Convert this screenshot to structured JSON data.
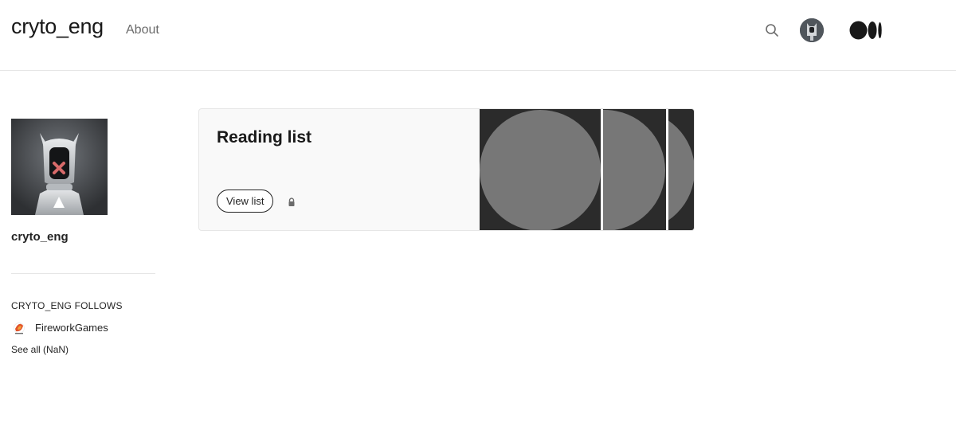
{
  "header": {
    "brand": "cryto_eng",
    "nav_about": "About",
    "icons": [
      "search-icon",
      "user-avatar",
      "medium-logo"
    ]
  },
  "profile": {
    "name": "cryto_eng"
  },
  "follows": {
    "title": "CRYTO_ENG FOLLOWS",
    "items": [
      {
        "label": "FireworkGames",
        "icon": "firework-games-icon"
      }
    ],
    "see_all": "See all (NaN)"
  },
  "reading_list": {
    "title": "Reading list",
    "button_label": "View list",
    "private_icon": "lock-icon"
  },
  "colors": {
    "text": "#242424",
    "muted": "#6b6b6b",
    "border": "#e6e6e6",
    "card_bg": "#f9f9f9",
    "thumb_dark": "#2b2b2b",
    "thumb_circle": "#777777"
  }
}
